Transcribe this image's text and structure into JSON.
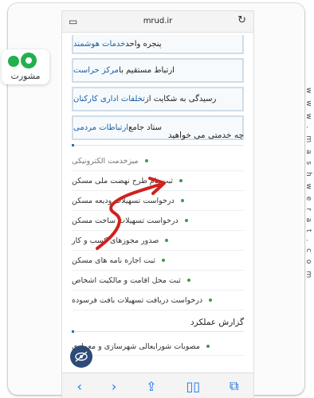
{
  "logo": {
    "text": "مشورت"
  },
  "watermark": "w w w . m a s h w e r a t . c o m",
  "browser": {
    "url": "mrud.ir"
  },
  "top_boxes": [
    {
      "plain": "پنجره واحد ",
      "blue": "خدمات هوشمند"
    },
    {
      "plain": "ارتباط مستقیم با ",
      "blue": "مرکز حراست"
    },
    {
      "plain": "رسیدگی به شکایت از ",
      "blue": "تخلفات اداری کارکنان"
    },
    {
      "plain": "ستاد جامع ",
      "blue": "ارتباطات مردمی"
    }
  ],
  "services": {
    "title": "چه خدمتی می خواهید",
    "items": [
      "میزخدمت الکترونیکی",
      "ثبت نام طرح نهضت ملی مسکن",
      "درخواست تسهیلات ودیعه مسکن",
      "درخواست تسهیلات ساخت مسکن",
      "صدور مجوزهای کسب و کار",
      "ثبت اجاره نامه های مسکن",
      "ثبت محل اقامت و مالکیت اشخاص",
      "درخواست دریافت تسهیلات بافت فرسوده"
    ]
  },
  "report": {
    "title": "گزارش عملکرد",
    "items": [
      "مصوبات شورایعالی شهرسازی و معماری"
    ]
  },
  "icons": {
    "tabs": "tabs-icon",
    "reload": "reload-icon",
    "back": "back-icon",
    "forward": "forward-icon",
    "share": "share-icon",
    "bookmarks": "bookmarks-icon",
    "tab_switcher": "tab-switcher-icon",
    "accessibility": "eye-slash-icon"
  },
  "colors": {
    "brand_green": "#22b14c",
    "link_blue": "#1a5fa8",
    "arrow_red": "#d0211c",
    "toolbar_blue": "#1a73e8"
  }
}
